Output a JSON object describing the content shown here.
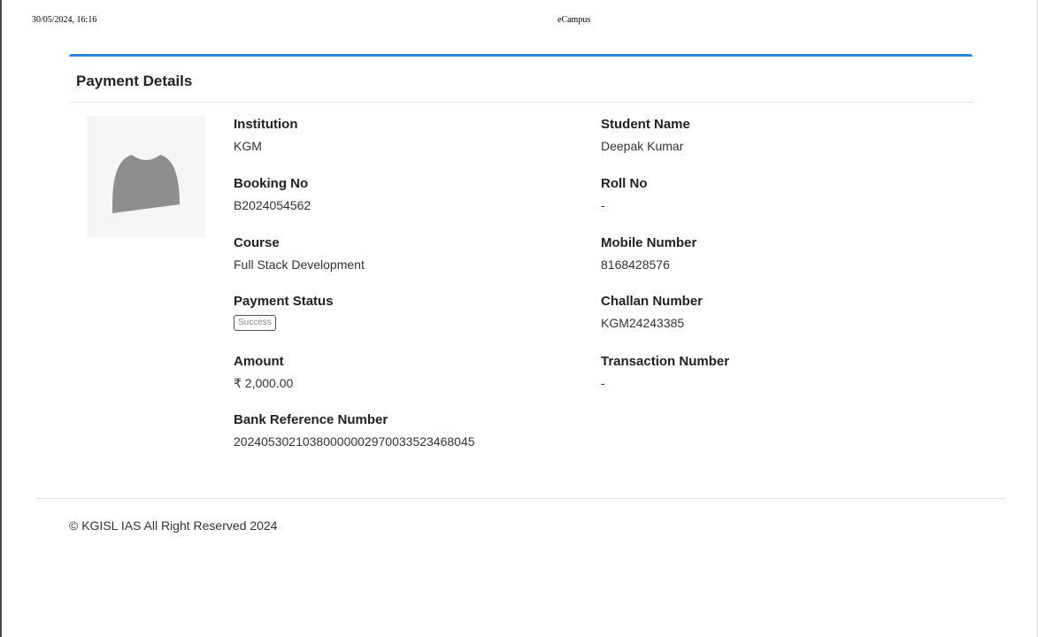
{
  "print_header": {
    "datetime": "30/05/2024, 16:16",
    "title": "eCampus"
  },
  "card": {
    "title": "Payment Details",
    "avatar_icon": "user-silhouette-icon",
    "left_column": [
      {
        "label": "Institution",
        "value": "KGM"
      },
      {
        "label": "Booking No",
        "value": "B2024054562"
      },
      {
        "label": "Course",
        "value": "Full Stack Development"
      },
      {
        "label": "Payment Status",
        "value": "Success",
        "type": "badge"
      },
      {
        "label": "Amount",
        "value": "₹ 2,000.00"
      },
      {
        "label": "Bank Reference Number",
        "value": "20240530210380000002970033523468045"
      }
    ],
    "right_column": [
      {
        "label": "Student Name",
        "value": "Deepak Kumar"
      },
      {
        "label": "Roll No",
        "value": "-"
      },
      {
        "label": "Mobile Number",
        "value": "8168428576"
      },
      {
        "label": "Challan Number",
        "value": "KGM24243385"
      },
      {
        "label": "Transaction Number",
        "value": "-"
      }
    ]
  },
  "footer": {
    "copyright": "© KGISL IAS All Right Reserved 2024"
  },
  "colors": {
    "accent": "#2b86e6",
    "avatar_fill": "#8e8e8e"
  }
}
